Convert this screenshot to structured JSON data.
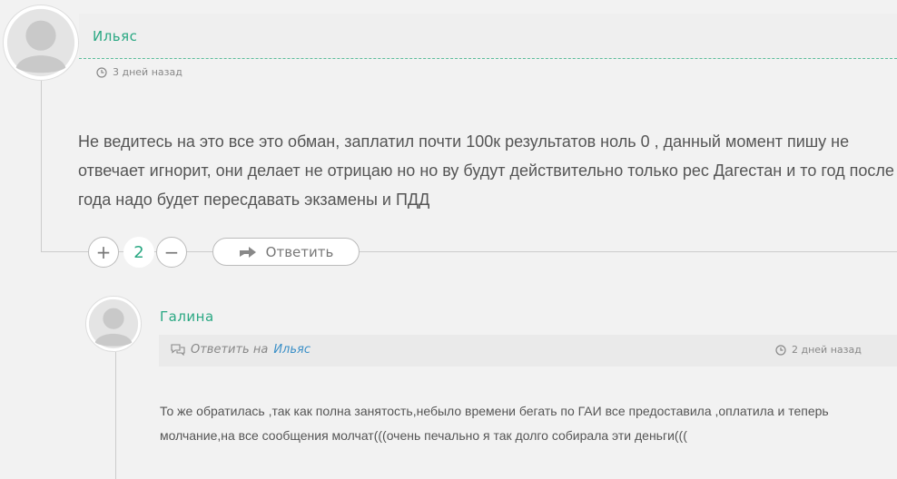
{
  "comments": [
    {
      "author": "Ильяс",
      "time": "3 дней назад",
      "text": "Не ведитесь на это все это обман, заплатил почти 100к результатов ноль 0 , данный момент пишу не отвечает игнорит, они делает не отрицаю но но ву будут действительно только рес Дагестан и то год после года надо будет пересдавать экзамены и ПДД",
      "vote_plus": "+",
      "vote_count": "2",
      "vote_minus": "−",
      "reply_label": "Ответить",
      "icons": {
        "time": "clock-icon",
        "reply": "reply-arrow-icon"
      }
    },
    {
      "author": "Галина",
      "reply_to_prefix": "Ответить на",
      "reply_to_name": "Ильяс",
      "time": "2 дней назад",
      "text": "То же обратилась ,так как полна занятость,небыло времени бегать по ГАИ все предоставила ,оплатила и теперь молчание,на все сообщения молчат(((очень печально я так долго собирала эти деньги(((",
      "icons": {
        "time": "clock-icon",
        "reply": "speech-bubbles-icon"
      }
    }
  ],
  "colors": {
    "author": "#2aa883",
    "link": "#3a8fc7",
    "background": "#f2f2f2"
  }
}
